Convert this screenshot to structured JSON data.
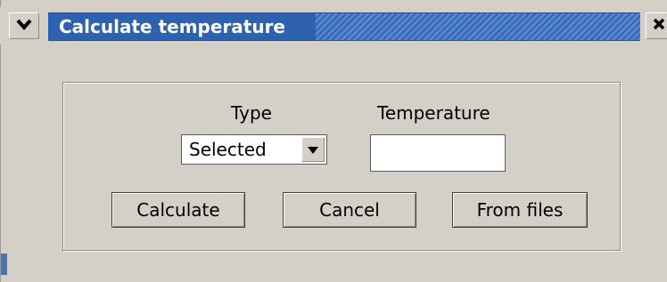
{
  "window": {
    "title": "Calculate temperature",
    "title_color": "#2d62b0",
    "menu_icon": "chevron-down-icon",
    "close_icon": "close-icon"
  },
  "form": {
    "type_label": "Type",
    "type_selected": "Selected",
    "temperature_label": "Temperature",
    "temperature_value": ""
  },
  "buttons": {
    "calculate": "Calculate",
    "cancel": "Cancel",
    "from_files": "From files"
  }
}
